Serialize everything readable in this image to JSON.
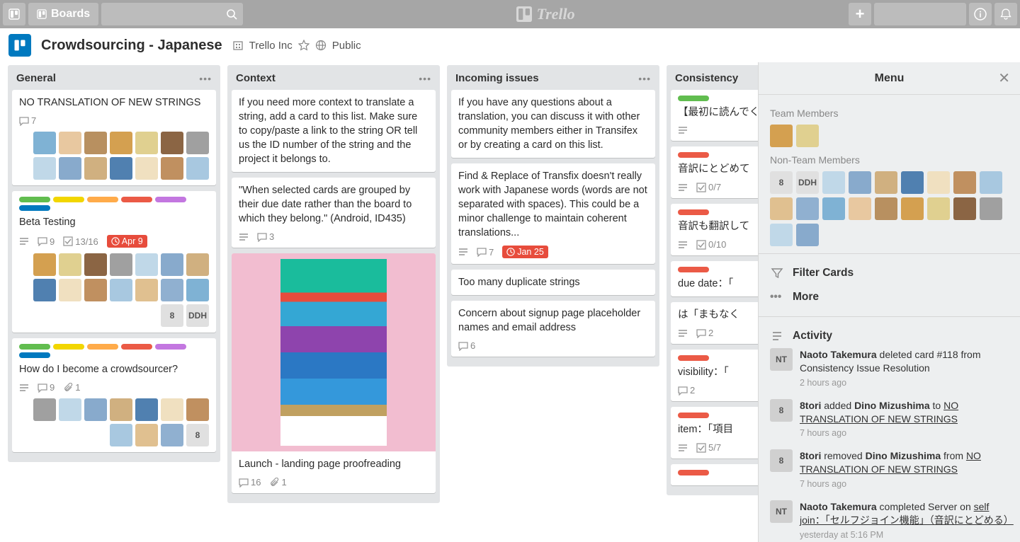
{
  "topbar": {
    "boards": "Boards"
  },
  "boardbar": {
    "title": "Crowdsourcing - Japanese",
    "org": "Trello Inc",
    "visibility": "Public"
  },
  "lists": [
    {
      "title": "General",
      "cards": [
        {
          "text": "NO TRANSLATION OF NEW STRINGS",
          "comments": "7",
          "members": 14
        },
        {
          "text": "Beta Testing",
          "labels": [
            "#61bd4f",
            "#f2d600",
            "#ffab4a",
            "#eb5a46",
            "#c377e0",
            "#0079bf"
          ],
          "desc": true,
          "comments": "9",
          "checklist": "13/16",
          "due": "Apr 9",
          "members": 14,
          "extra": [
            "8",
            "DDH"
          ]
        },
        {
          "text": "How do I become a crowdsourcer?",
          "labels": [
            "#61bd4f",
            "#f2d600",
            "#ffab4a",
            "#eb5a46",
            "#c377e0",
            "#0079bf"
          ],
          "desc": true,
          "comments": "9",
          "attach": "1",
          "members": 10,
          "extra": [
            "8"
          ]
        }
      ]
    },
    {
      "title": "Context",
      "cards": [
        {
          "text": "If you need more context to translate a string, add a card to this list. Make sure to copy/paste a link to the string OR tell us the ID number of the string and the project it belongs to."
        },
        {
          "text": "\"When selected cards are grouped by their due date rather than the board to which they belong.\" (Android, ID435)",
          "desc": true,
          "comments": "3"
        },
        {
          "text": "Launch - landing page proofreading",
          "cover": true,
          "comments": "16",
          "attach": "1"
        }
      ]
    },
    {
      "title": "Incoming issues",
      "cards": [
        {
          "text": "If you have any questions about a translation, you can discuss it with other community members either in Transifex or by creating a card on this list."
        },
        {
          "text": "Find & Replace of Transfix doesn't really work with Japanese words (words are not separated with spaces). This could be a minor challenge to maintain coherent translations...",
          "desc": true,
          "comments": "7",
          "due": "Jan 25"
        },
        {
          "text": "Too many duplicate strings"
        },
        {
          "text": "Concern about signup page placeholder names and email address",
          "comments": "6"
        }
      ]
    },
    {
      "title": "Consistency",
      "cards": [
        {
          "text": "【最初に読んでください】使用方法",
          "labels": [
            "#61bd4f"
          ],
          "desc": true
        },
        {
          "text": "音訳にとどめて",
          "labels": [
            "#eb5a46"
          ],
          "desc": true,
          "checklist": "0/7"
        },
        {
          "text": "音訳も翻訳して",
          "labels": [
            "#eb5a46"
          ],
          "desc": true,
          "checklist": "0/10"
        },
        {
          "text": "due date：「",
          "labels": [
            "#eb5a46"
          ]
        },
        {
          "text": "は「まもなく",
          "desc": true,
          "comments": "2"
        },
        {
          "text": "visibility：「",
          "labels": [
            "#eb5a46"
          ],
          "comments": "2"
        },
        {
          "text": "item：「項目",
          "labels": [
            "#eb5a46"
          ],
          "desc": true,
          "checklist": "5/7"
        },
        {
          "text": "",
          "labels": [
            "#eb5a46"
          ]
        }
      ]
    }
  ],
  "menu": {
    "title": "Menu",
    "team": "Team Members",
    "nonteam": "Non-Team Members",
    "team_count": 2,
    "nonteam_count": 18,
    "nonteam_extra": [
      "8",
      "DDH"
    ],
    "filter": "Filter Cards",
    "more": "More",
    "activity_label": "Activity",
    "activity": [
      {
        "who": "Naoto Takemura",
        "action": " deleted card #118 from Consistency Issue Resolution",
        "when": "2 hours ago",
        "av": "NT"
      },
      {
        "who": "8tori",
        "action_html": " added <b>Dino Mizushima</b> to <u>NO TRANSLATION OF NEW STRINGS</u>",
        "when": "7 hours ago",
        "av": "8"
      },
      {
        "who": "8tori",
        "action_html": " removed <b>Dino Mizushima</b> from <u>NO TRANSLATION OF NEW STRINGS</u>",
        "when": "7 hours ago",
        "av": "8"
      },
      {
        "who": "Naoto Takemura",
        "action_html": " completed Server on <u>self join：「セルフジョイン機能」（音訳にとどめる）</u>",
        "when": "yesterday at 5:16 PM",
        "av": "NT"
      }
    ]
  }
}
